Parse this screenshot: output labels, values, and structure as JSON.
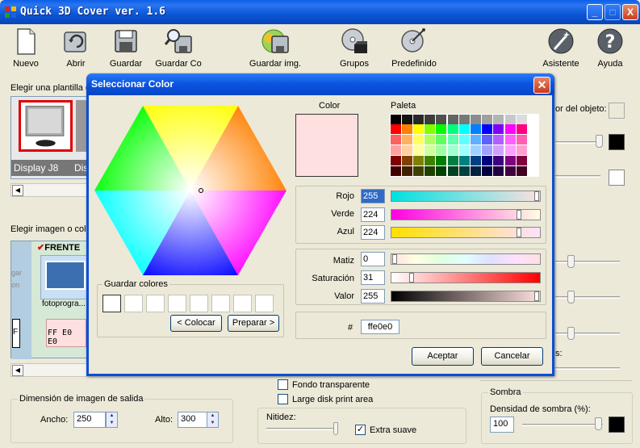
{
  "window": {
    "title": "Quick 3D Cover ver. 1.6",
    "min": "_",
    "max": "□",
    "close": "X"
  },
  "toolbar": [
    {
      "label": "Nuevo",
      "icon": "new-document-icon"
    },
    {
      "label": "Abrir",
      "icon": "open-folder-icon"
    },
    {
      "label": "Guardar",
      "icon": "floppy-disk-icon"
    },
    {
      "label": "Guardar Co",
      "icon": "save-as-search-icon"
    },
    {
      "label": "Guardar img.",
      "icon": "save-image-icon"
    },
    {
      "label": "Grupos",
      "icon": "groups-disc-icon"
    },
    {
      "label": "Predefinido",
      "icon": "predefined-disc-icon"
    },
    {
      "label": "Asistente",
      "icon": "wizard-wand-icon"
    },
    {
      "label": "Ayuda",
      "icon": "help-icon"
    }
  ],
  "left": {
    "template_label": "Elegir una plantilla d",
    "template_item1": "Display J8",
    "template_item2": "Dis",
    "image_label": "Elegir imagen o colo",
    "frente_label": "FRENTE",
    "foto_label": "fotoprogra...",
    "color_tile": "FF E0 E0",
    "side_text": "gar\non",
    "f_tile": "F"
  },
  "right": {
    "object_color_label": "or del objeto:",
    "s_label": "s:"
  },
  "bottom": {
    "fondo_transparente": "Fondo transparente",
    "large_disk": "Large disk print area",
    "nitidez": "Nitidez:",
    "extra_suave": "Extra suave",
    "dimension_group": "Dimensión de imagen de salida",
    "ancho_label": "Ancho:",
    "ancho_value": "250",
    "alto_label": "Alto:",
    "alto_value": "300",
    "sombra_group": "Sombra",
    "densidad_label": "Densidad de sombra (%):",
    "densidad_value": "100"
  },
  "dialog": {
    "title": "Seleccionar Color",
    "color_label": "Color",
    "paleta_label": "Paleta",
    "rojo_label": "Rojo",
    "rojo_value": "255",
    "verde_label": "Verde",
    "verde_value": "224",
    "azul_label": "Azul",
    "azul_value": "224",
    "matiz_label": "Matiz",
    "matiz_value": "0",
    "saturacion_label": "Saturación",
    "saturacion_value": "31",
    "valor_label": "Valor",
    "valor_value": "255",
    "hash_label": "#",
    "hex_value": "ffe0e0",
    "guardar_colores": "Guardar colores",
    "colocar_button": "< Colocar",
    "preparar_button": "Preparar >",
    "aceptar_button": "Aceptar",
    "cancelar_button": "Cancelar",
    "selected_color": "#ffe0e0",
    "palette": [
      [
        "#000000",
        "#141414",
        "#282828",
        "#3c3c3c",
        "#505050",
        "#646464",
        "#787878",
        "#8c8c8c",
        "#a0a0a0",
        "#b4b4b4",
        "#c8c8c8",
        "#dcdcdc",
        "#ffffff"
      ],
      [
        "#ff0000",
        "#ff8000",
        "#ffff00",
        "#80ff00",
        "#00ff00",
        "#00ff80",
        "#00ffff",
        "#0080ff",
        "#0000ff",
        "#8000ff",
        "#ff00ff",
        "#ff0080"
      ],
      [
        "#ff6060",
        "#ffb060",
        "#ffff60",
        "#b0ff60",
        "#60ff60",
        "#60ffb0",
        "#60ffff",
        "#60b0ff",
        "#6060ff",
        "#b060ff",
        "#ff60ff",
        "#ff60b0"
      ],
      [
        "#ffa0a0",
        "#ffd0a0",
        "#ffffa0",
        "#d0ffa0",
        "#a0ffa0",
        "#a0ffd0",
        "#a0ffff",
        "#a0d0ff",
        "#a0a0ff",
        "#d0a0ff",
        "#ffa0ff",
        "#ffa0d0"
      ],
      [
        "#800000",
        "#804000",
        "#808000",
        "#408000",
        "#008000",
        "#008040",
        "#008080",
        "#004080",
        "#000080",
        "#400080",
        "#800080",
        "#800040"
      ],
      [
        "#400000",
        "#402000",
        "#404000",
        "#204000",
        "#004000",
        "#004020",
        "#004040",
        "#002040",
        "#000040",
        "#200040",
        "#400040",
        "#400020"
      ]
    ]
  }
}
